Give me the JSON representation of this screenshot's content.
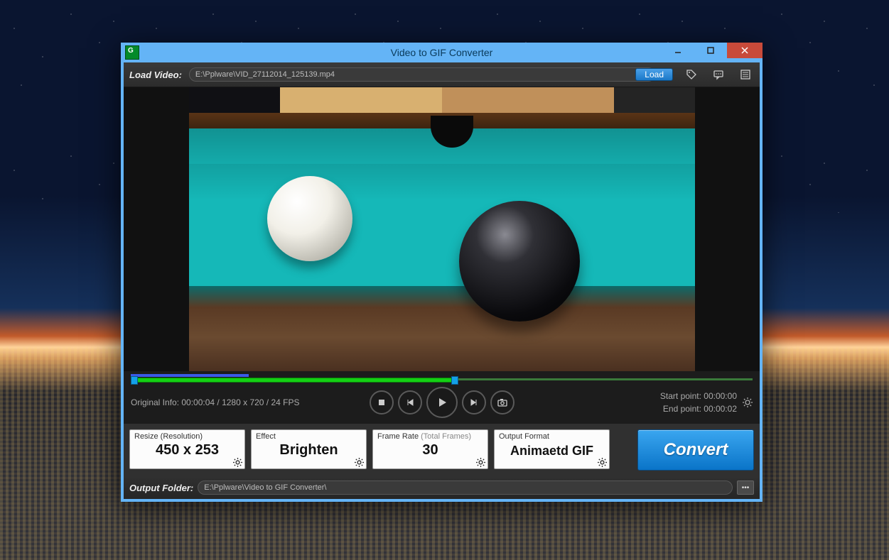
{
  "window": {
    "title": "Video to GIF Converter"
  },
  "loadbar": {
    "label": "Load Video:",
    "path": "E:\\Pplware\\VID_27112014_125139.mp4",
    "load_btn": "Load"
  },
  "original_info": "Original Info: 00:00:04 / 1280 x 720 / 24 FPS",
  "points": {
    "start_label": "Start point:",
    "start_value": "00:00:00",
    "end_label": "End point:",
    "end_value": "00:00:02"
  },
  "cards": {
    "resize": {
      "label": "Resize (Resolution)",
      "value": "450 x 253"
    },
    "effect": {
      "label": "Effect",
      "value": "Brighten"
    },
    "framerate": {
      "label": "Frame Rate",
      "sublabel": "(Total Frames)",
      "value": "30"
    },
    "format": {
      "label": "Output Format",
      "value": "Animaetd GIF"
    }
  },
  "convert_label": "Convert",
  "output": {
    "label": "Output Folder:",
    "path": "E:\\Pplware\\Video to GIF Converter\\",
    "browse": "•••"
  }
}
